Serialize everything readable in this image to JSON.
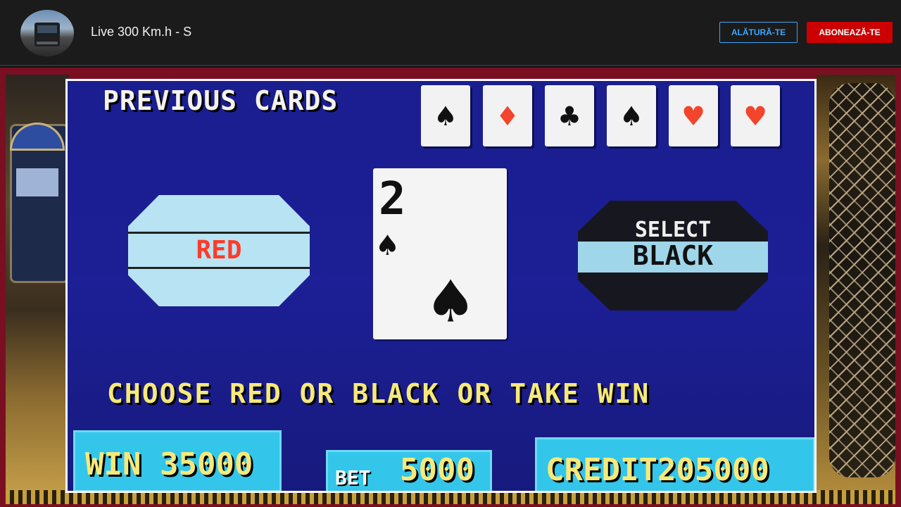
{
  "channel": {
    "title": "Live 300 Km.h - S",
    "join_label": "ALĂTURĂ-TE",
    "subscribe_label": "ABONEAZĂ-TE",
    "colors": {
      "join": "#3ea6ff",
      "subscribe": "#cc0000"
    }
  },
  "game": {
    "previous_cards_label": "PREVIOUS CARDS",
    "previous_cards": [
      {
        "suit": "spade-icon",
        "glyph": "♠",
        "color": "black"
      },
      {
        "suit": "diamond-icon",
        "glyph": "♦",
        "color": "red"
      },
      {
        "suit": "club-icon",
        "glyph": "♣",
        "color": "black"
      },
      {
        "suit": "spade-icon",
        "glyph": "♠",
        "color": "black"
      },
      {
        "suit": "heart-icon",
        "glyph": "♥",
        "color": "red"
      },
      {
        "suit": "heart-icon",
        "glyph": "♥",
        "color": "red"
      }
    ],
    "red_button_label": "RED",
    "current_card": {
      "rank": "2",
      "suit_glyph": "♠"
    },
    "black_button_select": "SELECT",
    "black_button_label": "BLACK",
    "instruction": "CHOOSE RED OR BLACK OR TAKE WIN",
    "win_text": "WIN 35000",
    "bet_label": "BET",
    "bet_value": "5000",
    "credit_text": "CREDIT205000"
  }
}
